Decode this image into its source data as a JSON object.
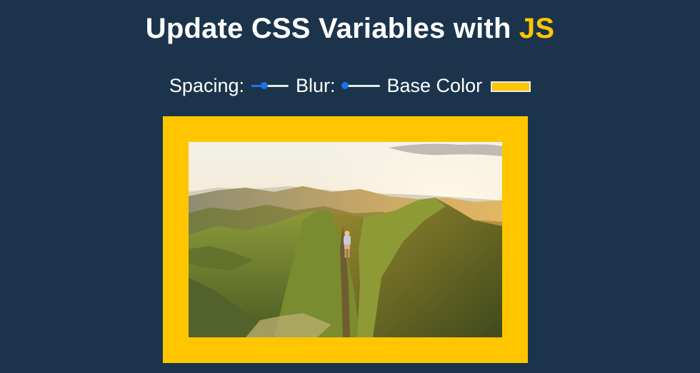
{
  "header": {
    "title_prefix": "Update CSS Variables with ",
    "title_highlight": "JS"
  },
  "controls": {
    "spacing_label": "Spacing:",
    "spacing_value": 0.35,
    "blur_label": "Blur:",
    "blur_value": 0.07,
    "base_color_label": "Base Color",
    "base_color_value": "#ffc600"
  },
  "colors": {
    "background": "#1b344c",
    "accent": "#ffc600",
    "slider": "#1a73e8"
  },
  "image": {
    "subject": "mountain-ridge-hiker-photo"
  }
}
